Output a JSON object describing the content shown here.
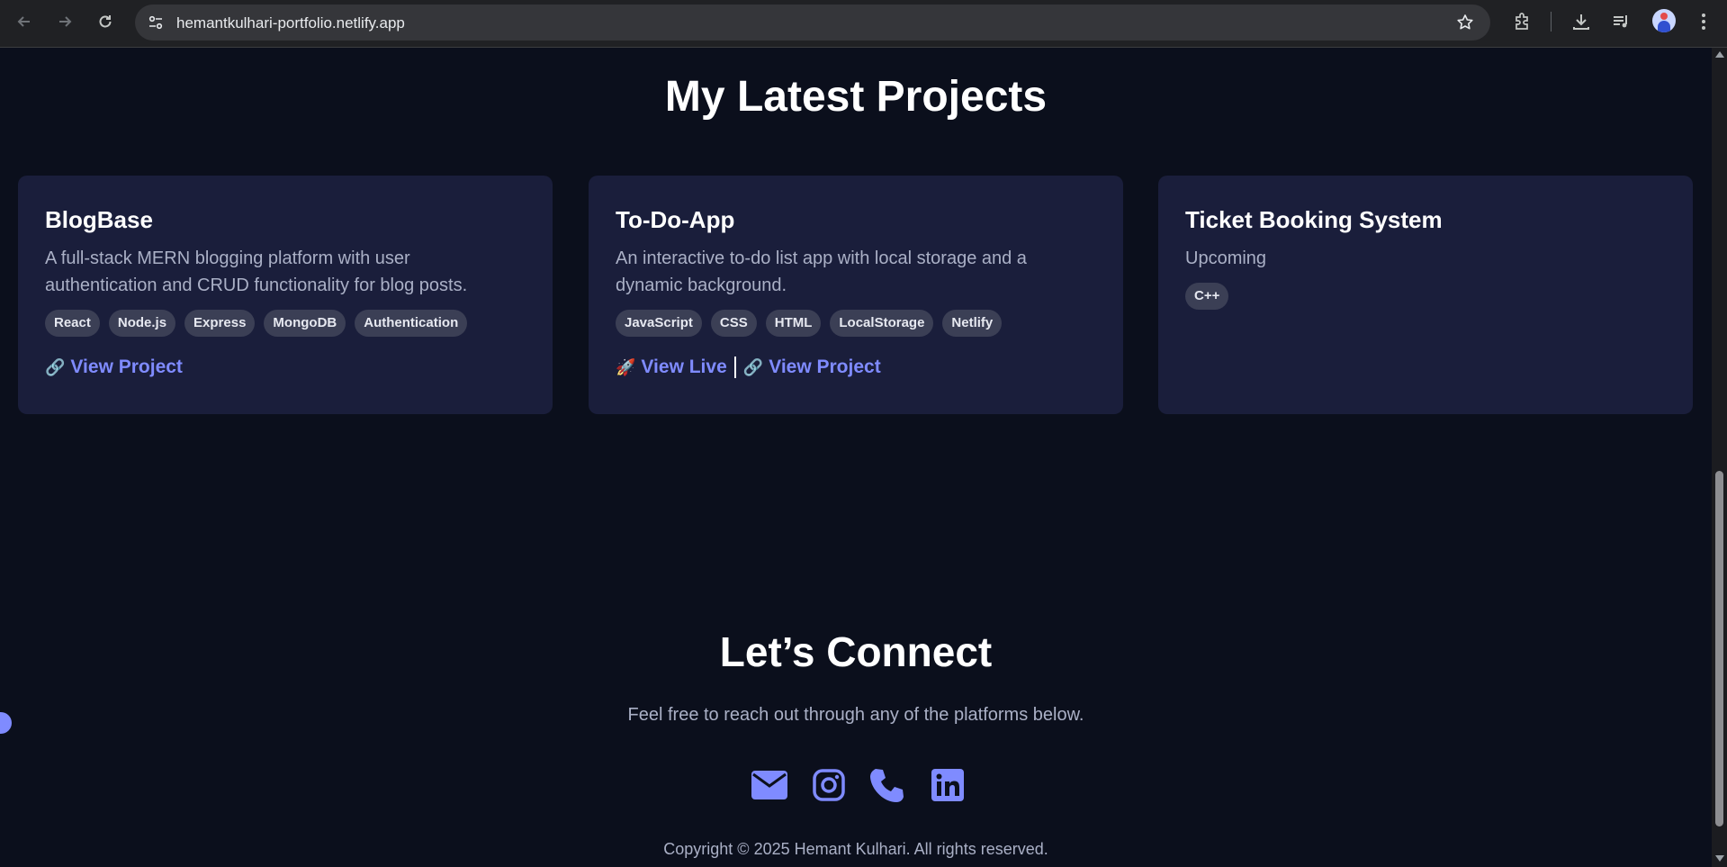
{
  "browser": {
    "url": "hemantkulhari-portfolio.netlify.app",
    "icons": [
      "back-icon",
      "forward-icon",
      "reload-icon",
      "site-info-icon",
      "bookmark-star-icon",
      "extensions-icon",
      "download-icon",
      "media-control-icon",
      "profile-avatar",
      "menu-icon"
    ]
  },
  "projects": {
    "title": "My Latest Projects",
    "cards": [
      {
        "title": "BlogBase",
        "description": "A full-stack MERN blogging platform with user authentication and CRUD functionality for blog posts.",
        "tags": [
          "React",
          "Node.js",
          "Express",
          "MongoDB",
          "Authentication"
        ],
        "links": [
          {
            "emoji": "🔗",
            "label": "View Project"
          }
        ]
      },
      {
        "title": "To-Do-App",
        "description": "An interactive to-do list app with local storage and a dynamic background.",
        "tags": [
          "JavaScript",
          "CSS",
          "HTML",
          "LocalStorage",
          "Netlify"
        ],
        "links": [
          {
            "emoji": "🚀",
            "label": "View Live"
          },
          {
            "emoji": "🔗",
            "label": "View Project"
          }
        ]
      },
      {
        "title": "Ticket Booking System",
        "description": "Upcoming",
        "tags": [
          "C++"
        ],
        "links": []
      }
    ]
  },
  "connect": {
    "title": "Let’s Connect",
    "subtitle": "Feel free to reach out through any of the platforms below.",
    "socials": [
      "email-icon",
      "instagram-icon",
      "phone-icon",
      "linkedin-icon"
    ]
  },
  "footer": {
    "copyright": "Copyright © 2025 Hemant Kulhari. All rights reserved."
  },
  "colors": {
    "background": "#0b0f1c",
    "card": "#1a1e3b",
    "accent": "#7f8bff",
    "tag": "#3b3f55"
  }
}
